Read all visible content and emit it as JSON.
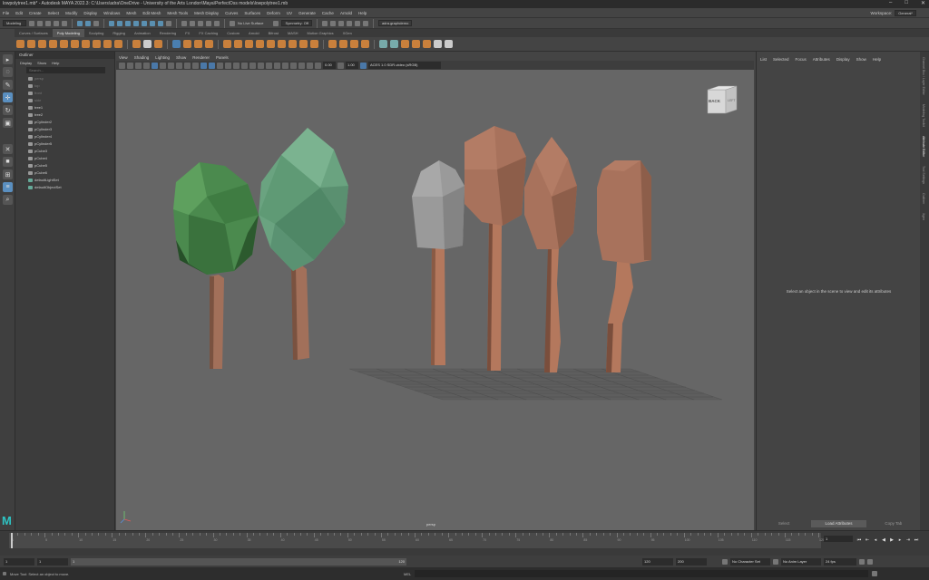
{
  "title_bar": {
    "text": "lowpolytree1.mb* - Autodesk MAYA 2022.3: C:\\Users\\adra\\OneDrive - University of the Arts London\\Maya\\PerfectOss models\\lowpolytree1.mb",
    "minimize": "–",
    "maximize": "□",
    "close": "✕"
  },
  "menu": [
    "File",
    "Edit",
    "Create",
    "Select",
    "Modify",
    "Display",
    "Windows",
    "Mesh",
    "Edit Mesh",
    "Mesh Tools",
    "Mesh Display",
    "Curves",
    "Surfaces",
    "Deform",
    "UV",
    "Generate",
    "Cache",
    "Arnold",
    "Help"
  ],
  "workspace": {
    "label": "Workspace:",
    "value": "General*"
  },
  "status_line": {
    "mode": "Modeling",
    "live_surface": "No Live Surface",
    "symmetry": "Symmetry: Off",
    "sign_in": "adra.graphdemo"
  },
  "shelf_tabs": [
    "Curves / Surfaces",
    "Poly Modeling",
    "Sculpting",
    "Rigging",
    "Animation",
    "Rendering",
    "FX",
    "FX Caching",
    "Custom",
    "Arnold",
    "Bifrost",
    "MASH",
    "Motion Graphics",
    "XGen"
  ],
  "shelf_active": 1,
  "outliner": {
    "title": "Outliner",
    "menu": [
      "Display",
      "Show",
      "Help"
    ],
    "search_placeholder": "Search...",
    "items": [
      {
        "label": "persp",
        "dim": true,
        "icon": "camera-icon"
      },
      {
        "label": "top",
        "dim": true,
        "icon": "camera-icon"
      },
      {
        "label": "front",
        "dim": true,
        "icon": "camera-icon"
      },
      {
        "label": "side",
        "dim": true,
        "icon": "camera-icon"
      },
      {
        "label": "tree1",
        "dim": false,
        "icon": "group-icon"
      },
      {
        "label": "tree2",
        "dim": false,
        "icon": "group-icon"
      },
      {
        "label": "pCylinder2",
        "dim": false,
        "icon": "mesh-icon"
      },
      {
        "label": "pCylinder3",
        "dim": false,
        "icon": "mesh-icon"
      },
      {
        "label": "pCylinder4",
        "dim": false,
        "icon": "mesh-icon"
      },
      {
        "label": "pCylinder5",
        "dim": false,
        "icon": "mesh-icon"
      },
      {
        "label": "pCube3",
        "dim": false,
        "icon": "mesh-icon"
      },
      {
        "label": "pCube4",
        "dim": false,
        "icon": "mesh-icon"
      },
      {
        "label": "pCube5",
        "dim": false,
        "icon": "mesh-icon"
      },
      {
        "label": "pCube6",
        "dim": false,
        "icon": "mesh-icon"
      },
      {
        "label": "defaultLightSet",
        "dim": false,
        "icon": "set-icon"
      },
      {
        "label": "defaultObjectSet",
        "dim": false,
        "icon": "set-icon"
      }
    ]
  },
  "viewport": {
    "menu": [
      "View",
      "Shading",
      "Lighting",
      "Show",
      "Renderer",
      "Panels"
    ],
    "exposure": "0.00",
    "gamma": "1.00",
    "colorspace": "ACES 1.0 SDR-video (sRGB)",
    "camera_label": "persp",
    "viewcube_left": "BACK",
    "viewcube_right": "LEFT"
  },
  "attribute_editor": {
    "menu": [
      "List",
      "Selected",
      "Focus",
      "Attributes",
      "Display",
      "Show",
      "Help"
    ],
    "message": "Select an object in the scene to view and edit its attributes",
    "buttons": [
      "Select",
      "Load Attributes",
      "Copy Tab"
    ]
  },
  "side_tabs": [
    "Channel Box / Layer Editor",
    "Modeling Toolkit",
    "Attribute Editor",
    "Tool Settings",
    "Outliner",
    "Xgen"
  ],
  "time_slider": {
    "tick_labels": [
      "1",
      "5",
      "10",
      "15",
      "20",
      "25",
      "30",
      "35",
      "40",
      "45",
      "50",
      "55",
      "60",
      "65",
      "70",
      "75",
      "80",
      "85",
      "90",
      "95",
      "100",
      "105",
      "110",
      "115",
      "120"
    ],
    "current_frame": "1"
  },
  "range_slider": {
    "start": "1",
    "start_inner": "1",
    "range_start": "1",
    "range_end": "120",
    "end_inner": "120",
    "end": "200",
    "character_set": "No Character Set",
    "anim_layer": "No Anim Layer",
    "fps": "24 fps"
  },
  "command_line": {
    "lang": "MEL",
    "help_text": "Move Tool: Select an object to move."
  }
}
